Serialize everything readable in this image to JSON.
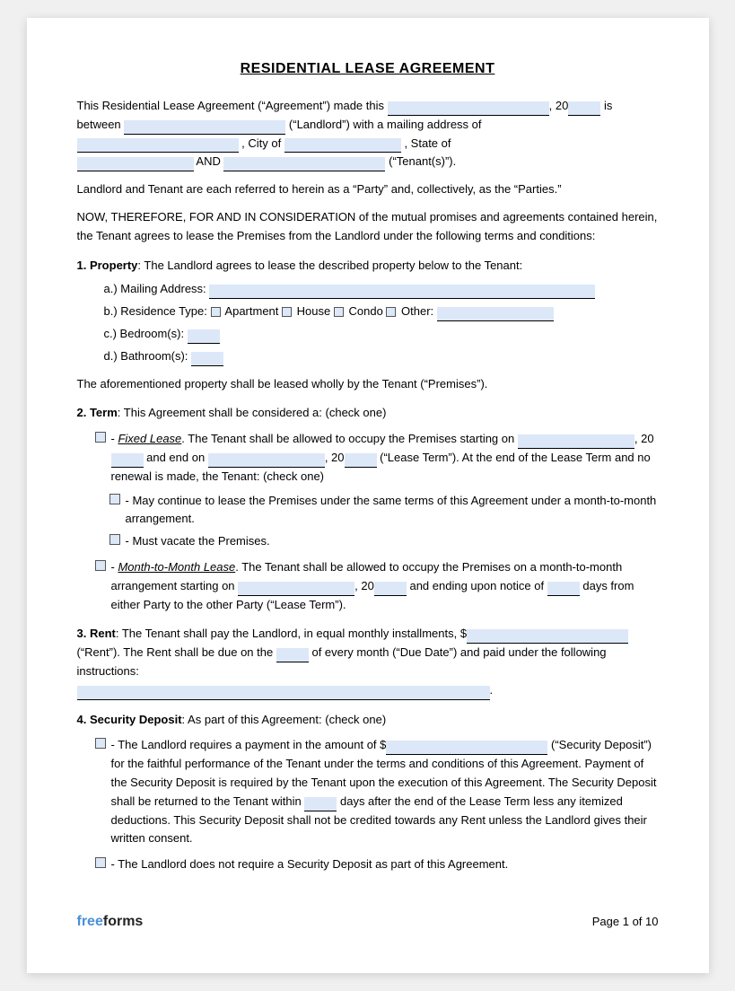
{
  "title": "RESIDENTIAL LEASE AGREEMENT",
  "intro": {
    "line1": "This Residential Lease Agreement (“Agreement”) made this",
    "line1b": ", 20",
    "line1c": "is",
    "line2": "between",
    "line2b": "(“Landlord”) with a mailing address of",
    "line3b": ", City of",
    "line3c": ", State of",
    "line4a": "AND",
    "line4b": "(“Tenant(s)”)."
  },
  "party_note": "Landlord and Tenant are each referred to herein as a “Party” and, collectively, as the “Parties.”",
  "consideration": "NOW, THEREFORE, FOR AND IN CONSIDERATION of the mutual promises and agreements contained herein, the Tenant agrees to lease the Premises from the Landlord under the following terms and conditions:",
  "section1": {
    "heading": "1. Property",
    "text": ": The Landlord agrees to lease the described property below to the Tenant:",
    "a": "a.)  Mailing Address:",
    "b_pre": "b.)  Residence Type:",
    "b_apartment": "Apartment",
    "b_house": "House",
    "b_condo": "Condo",
    "b_other": "Other:",
    "c": "c.)  Bedroom(s):",
    "d": "d.)  Bathroom(s):",
    "closing": "The aforementioned property shall be leased wholly by the Tenant (“Premises”)."
  },
  "section2": {
    "heading": "2. Term",
    "text": ": This Agreement shall be considered a: (check one)",
    "fixed_label": "Fixed Lease",
    "fixed_text1": ". The Tenant shall be allowed to occupy the Premises starting on",
    "fixed_text2": ", 20",
    "fixed_text3": "and end on",
    "fixed_text4": ", 20",
    "fixed_text5": "(“Lease Term”). At the end of the Lease Term and no renewal is made, the Tenant: (check one)",
    "option1": "- May continue to lease the Premises under the same terms of this Agreement under a month-to-month arrangement.",
    "option2": "- Must vacate the Premises.",
    "month_label": "Month-to-Month Lease",
    "month_text1": ". The Tenant shall be allowed to occupy the Premises on a month-to-month arrangement starting on",
    "month_text2": ", 20",
    "month_text3": "and ending upon notice of",
    "month_text4": "days from either Party to the other Party (“Lease Term”)."
  },
  "section3": {
    "heading": "3. Rent",
    "text1": ": The Tenant shall pay the Landlord, in equal monthly installments, $",
    "text2": "(“Rent”). The Rent shall be due on the",
    "text3": "of every month (“Due Date”) and paid under the following instructions:",
    "end": "."
  },
  "section4": {
    "heading": "4. Security Deposit",
    "text_intro": ": As part of this Agreement: (check one)",
    "option1_pre": "- The Landlord requires a payment in the amount of $",
    "option1_post": "(“Security Deposit”) for the faithful performance of the Tenant under the terms and conditions of this Agreement. Payment of the Security Deposit is required by the Tenant upon the execution of this Agreement. The Security Deposit shall be returned to the Tenant within",
    "option1_days": "days after the end of the Lease Term less any itemized deductions. This Security Deposit shall not be credited towards any Rent unless the Landlord gives their written consent.",
    "option2": "- The Landlord does not require a Security Deposit as part of this Agreement."
  },
  "footer": {
    "logo_free": "free",
    "logo_forms": "forms",
    "page_text": "Page 1 of 10"
  }
}
